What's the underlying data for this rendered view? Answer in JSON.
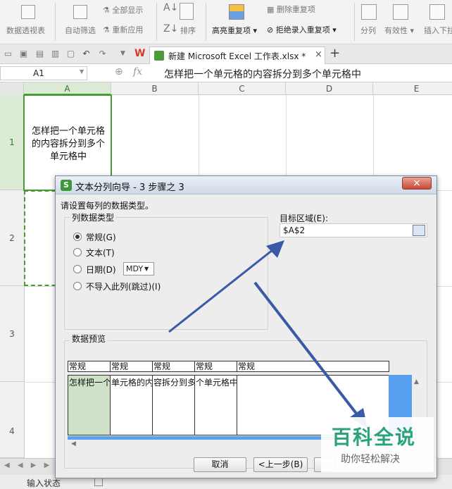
{
  "ribbon": {
    "pivot": "数据透视表",
    "auto_filter": "自动筛选",
    "show_all": "全部显示",
    "reapply": "重新应用",
    "sort": "排序",
    "highlight_dup": "高亮重复项",
    "remove_dup": "删除重复项",
    "reject_dup": "拒绝录入重复项",
    "split": "分列",
    "validity": "有效性",
    "insert_dropdown": "插入下拉"
  },
  "tab": {
    "title": "新建 Microsoft Excel 工作表.xlsx *",
    "close": "×",
    "add": "+"
  },
  "formula": {
    "name_box": "A1",
    "fx": "fx",
    "content": "怎样把一个单元格的内容拆分到多个单元格中"
  },
  "sheet": {
    "columns": [
      "A",
      "B",
      "C",
      "D",
      "E"
    ],
    "rows": [
      "1",
      "2",
      "3",
      "4"
    ],
    "a1_text": "怎样把一个单元格的内容拆分到多个单元格中"
  },
  "dialog": {
    "title": "文本分列向导 - 3 步骤之 3",
    "close": "×",
    "prompt": "请设置每列的数据类型。",
    "type_group": "列数据类型",
    "options": [
      "常规(G)",
      "文本(T)",
      "日期(D)",
      "不导入此列(跳过)(I)"
    ],
    "date_format": "MDY",
    "target_label": "目标区域(E):",
    "target_value": "$A$2",
    "preview_label": "数据预览",
    "preview_headers": [
      "常规",
      "常规",
      "常规",
      "常规",
      "常规"
    ],
    "preview_cells": [
      "怎样把一个",
      "单元格的内",
      "容拆分到多",
      "个单元格中",
      ""
    ],
    "cancel": "取消",
    "back": "<上一步(B)"
  },
  "sheet_tabs": {
    "nav": "◀ ◀ ▶ ▶"
  },
  "status": {
    "mode": "输入状态"
  },
  "watermark": {
    "title": "百科全说",
    "subtitle": "助你轻松解决"
  },
  "colors": {
    "accent_green": "#4a9a37",
    "arrow": "#3a5aa8",
    "preview_blue": "#5aa0f0",
    "excel_red": "#d23a2a"
  }
}
